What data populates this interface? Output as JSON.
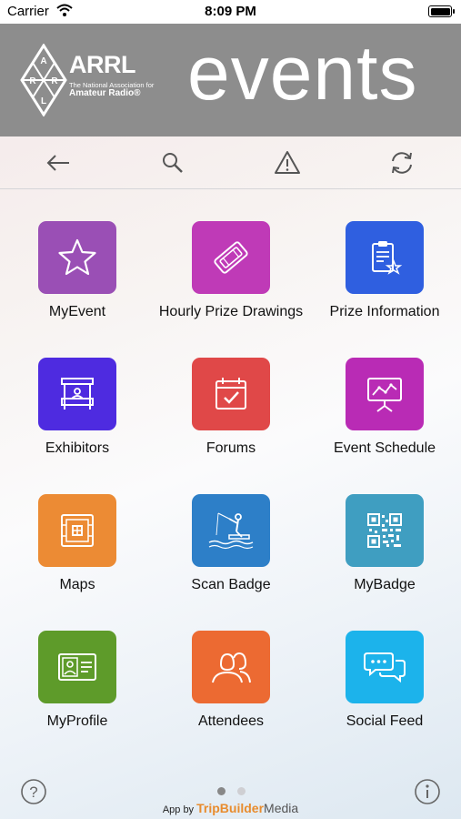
{
  "status": {
    "carrier": "Carrier",
    "time": "8:09 PM"
  },
  "banner": {
    "org_name": "ARRL",
    "org_tagline_1": "The National Association for",
    "org_tagline_2": "Amateur Radio®",
    "logo_letters": [
      "A",
      "R",
      "R",
      "L"
    ],
    "title": "events",
    "background": "#8d8d8d"
  },
  "toolbar": {
    "items": [
      "back-arrow-icon",
      "search-icon",
      "alert-icon",
      "sync-icon"
    ]
  },
  "tiles": [
    {
      "label": "MyEvent",
      "color": "#9a4fb5",
      "icon": "star-icon"
    },
    {
      "label": "Hourly Prize Drawings",
      "color": "#bf3ab7",
      "icon": "ticket-icon"
    },
    {
      "label": "Prize Information",
      "color": "#2f5fe0",
      "icon": "clipboard-icon"
    },
    {
      "label": "Exhibitors",
      "color": "#4e2be0",
      "icon": "booth-icon"
    },
    {
      "label": "Forums",
      "color": "#e04848",
      "icon": "calendar-check-icon"
    },
    {
      "label": "Event Schedule",
      "color": "#b92bb5",
      "icon": "presentation-icon"
    },
    {
      "label": "Maps",
      "color": "#ec8b34",
      "icon": "map-icon"
    },
    {
      "label": "Scan Badge",
      "color": "#2d7fc8",
      "icon": "fishing-icon"
    },
    {
      "label": "MyBadge",
      "color": "#3f9ec1",
      "icon": "qr-code-icon"
    },
    {
      "label": "MyProfile",
      "color": "#5e9b2a",
      "icon": "id-card-icon"
    },
    {
      "label": "Attendees",
      "color": "#ec6a32",
      "icon": "people-icon"
    },
    {
      "label": "Social Feed",
      "color": "#1cb3eb",
      "icon": "chat-bubbles-icon"
    }
  ],
  "footer": {
    "credit_prefix": "App by",
    "credit_brand": "TripBuilder",
    "credit_brand2": "Media",
    "page_count": 2,
    "current_page": 1
  }
}
